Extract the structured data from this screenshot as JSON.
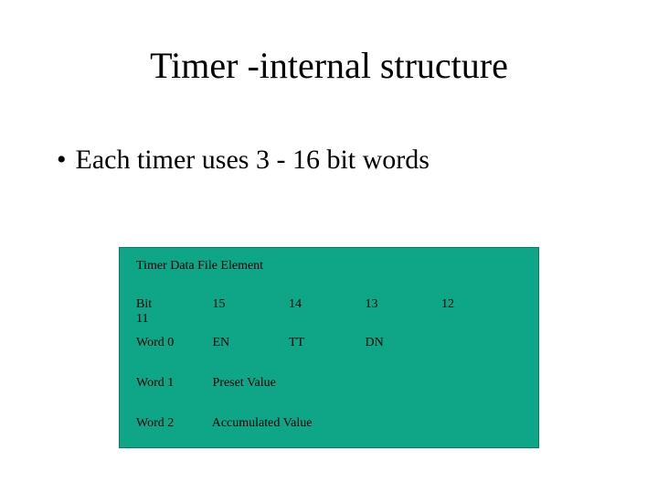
{
  "title": "Timer -internal structure",
  "bullet": "Each timer uses 3 - 16 bit words",
  "table": {
    "header": "Timer Data File Element",
    "row_bits": {
      "label": "Bit",
      "b15": "15",
      "b14": "14",
      "b13": "13",
      "b12": "12",
      "b11": "11"
    },
    "row_word0": {
      "label": "Word 0",
      "en": "EN",
      "tt": "TT",
      "dn": "DN"
    },
    "row_word1": {
      "label": "Word 1",
      "value": "Preset Value"
    },
    "row_word2": {
      "label": "Word 2",
      "value": "Accumulated Value"
    }
  }
}
